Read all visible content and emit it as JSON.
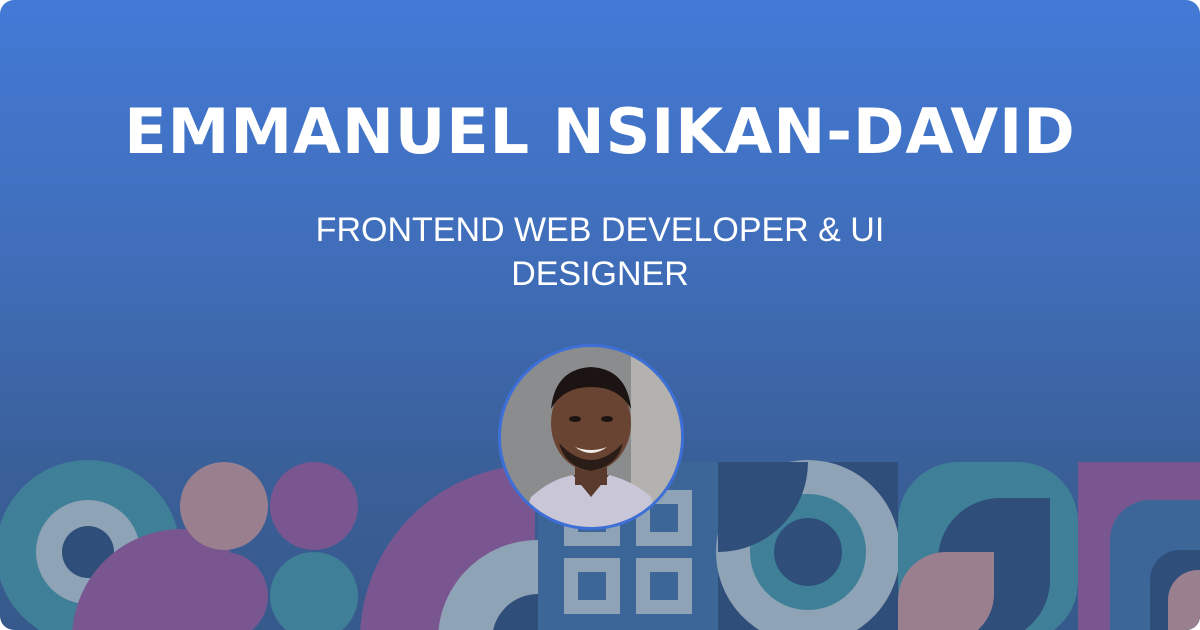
{
  "profile": {
    "name": "EMMANUEL NSIKAN-DAVID",
    "role": "FRONTEND WEB DEVELOPER & UI DESIGNER"
  },
  "colors": {
    "background_top": "#437ad6",
    "background_bottom": "#375a8c",
    "teal": "#3f7f97",
    "purple": "#7a5690",
    "mauve": "#9a7f8f",
    "slate": "#8fa3b6",
    "navy": "#2f4e79",
    "avatar_ring": "#3d6fd8"
  },
  "icons": {
    "avatar": "portrait-photo"
  }
}
